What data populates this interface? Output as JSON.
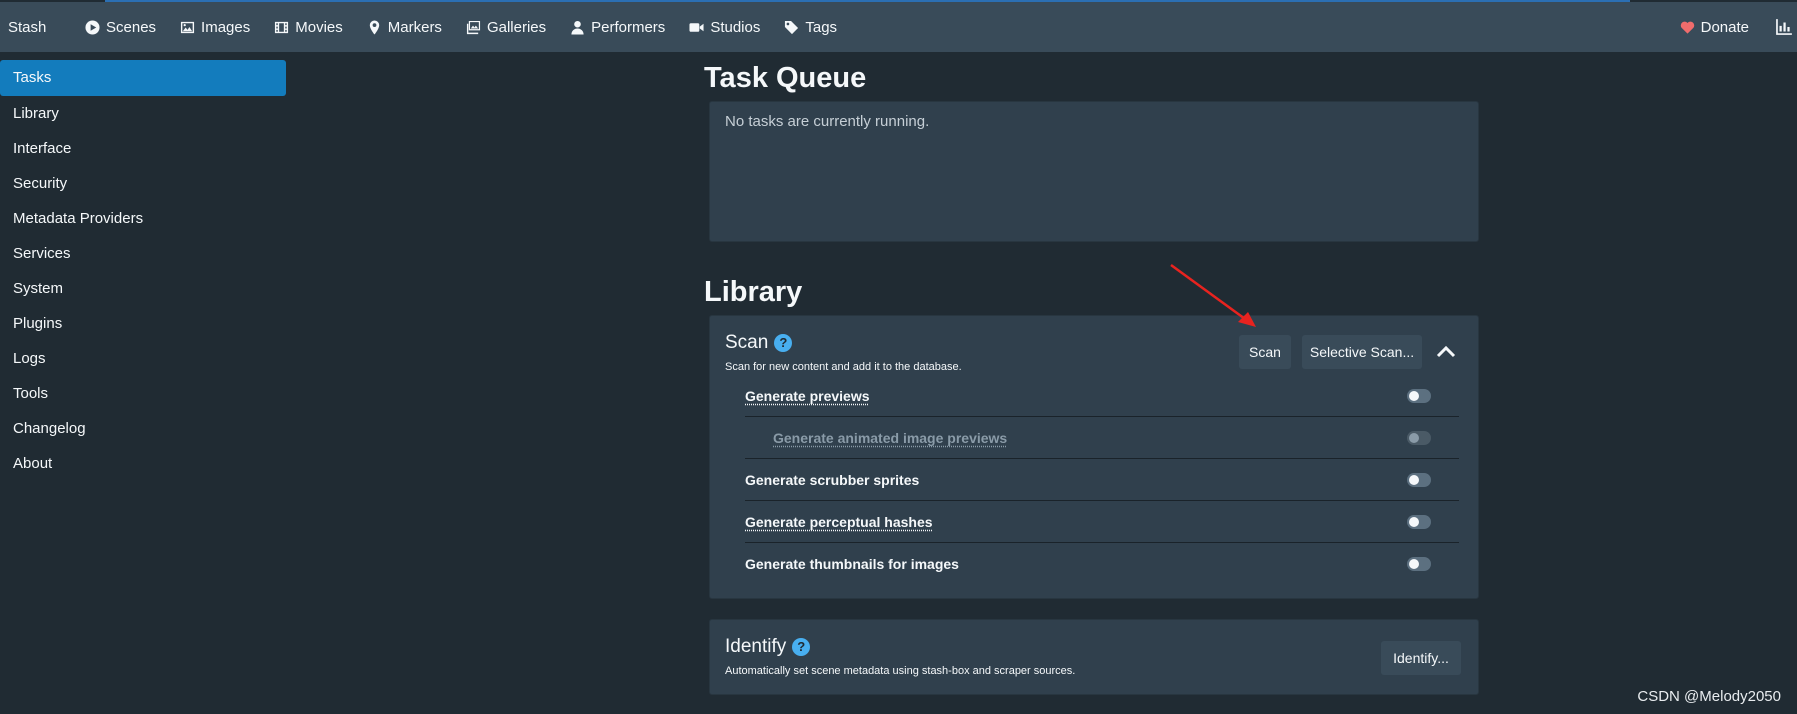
{
  "navbar": {
    "brand": "Stash",
    "items": [
      {
        "label": "Scenes",
        "icon": "play-circle-icon"
      },
      {
        "label": "Images",
        "icon": "image-icon"
      },
      {
        "label": "Movies",
        "icon": "film-icon"
      },
      {
        "label": "Markers",
        "icon": "map-marker-icon"
      },
      {
        "label": "Galleries",
        "icon": "images-icon"
      },
      {
        "label": "Performers",
        "icon": "user-icon"
      },
      {
        "label": "Studios",
        "icon": "video-icon"
      },
      {
        "label": "Tags",
        "icon": "tag-icon"
      }
    ],
    "donate_label": "Donate",
    "accent_color": "#137cbd"
  },
  "sidebar": {
    "items": [
      {
        "label": "Tasks",
        "active": true
      },
      {
        "label": "Library"
      },
      {
        "label": "Interface"
      },
      {
        "label": "Security"
      },
      {
        "label": "Metadata Providers"
      },
      {
        "label": "Services"
      },
      {
        "label": "System"
      },
      {
        "label": "Plugins"
      },
      {
        "label": "Logs"
      },
      {
        "label": "Tools"
      },
      {
        "label": "Changelog"
      },
      {
        "label": "About"
      }
    ]
  },
  "task_queue": {
    "title": "Task Queue",
    "empty_text": "No tasks are currently running."
  },
  "library": {
    "title": "Library",
    "scan": {
      "title": "Scan",
      "help": "?",
      "description": "Scan for new content and add it to the database.",
      "scan_button": "Scan",
      "selective_button": "Selective Scan...",
      "options": [
        {
          "label": "Generate previews",
          "enabled": false
        },
        {
          "label": "Generate animated image previews",
          "enabled": false,
          "disabled": true
        },
        {
          "label": "Generate scrubber sprites",
          "enabled": false
        },
        {
          "label": "Generate perceptual hashes",
          "enabled": false
        },
        {
          "label": "Generate thumbnails for images",
          "enabled": false
        }
      ]
    },
    "identify": {
      "title": "Identify",
      "help": "?",
      "description": "Automatically set scene metadata using stash-box and scraper sources.",
      "button": "Identify..."
    }
  },
  "watermark": "CSDN @Melody2050",
  "annotation": {
    "arrow_color": "#e8231f"
  }
}
